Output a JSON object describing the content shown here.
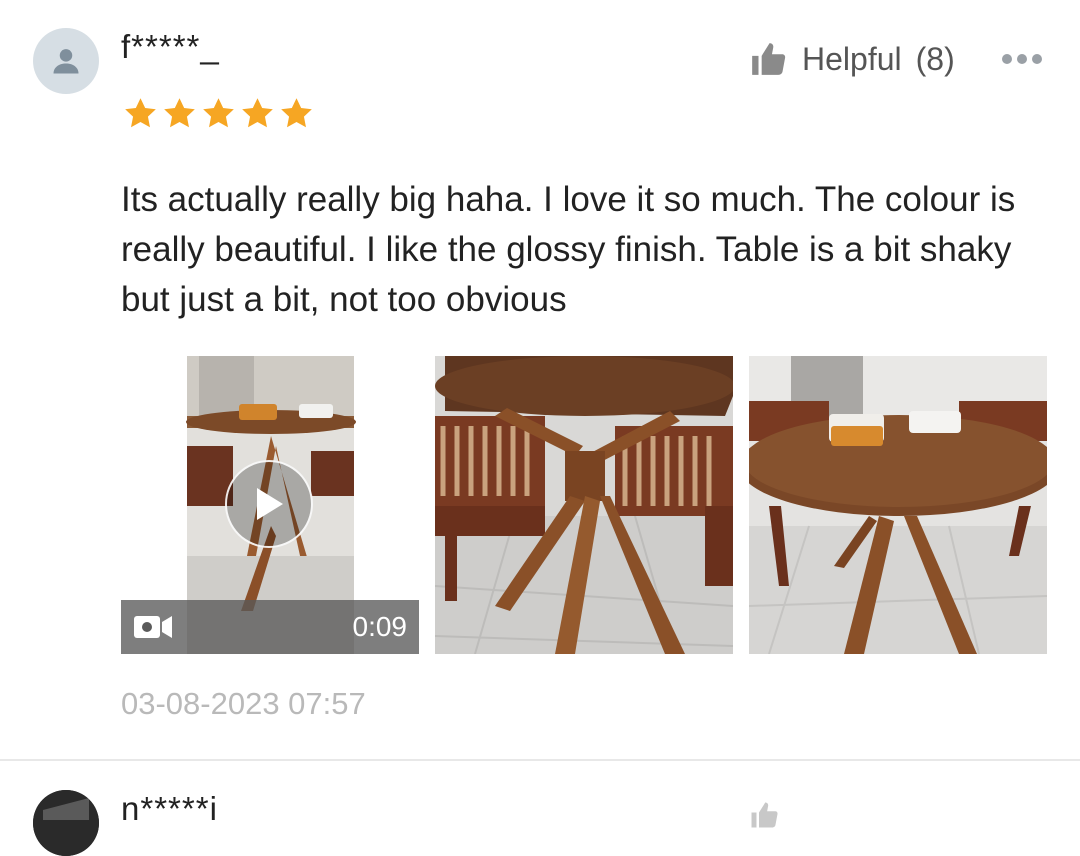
{
  "review": {
    "username": "f*****_",
    "rating": 5,
    "helpful_label": "Helpful",
    "helpful_count": "(8)",
    "text": "Its actually really big haha. I love it so much. The colour is really beautiful. I like the glossy finish. Table is a bit shaky but just a bit, not too obvious",
    "timestamp": "03-08-2023 07:57",
    "video": {
      "duration": "0:09",
      "icon": "video-camera-icon"
    },
    "photos": [
      {
        "name": "review-photo-1"
      },
      {
        "name": "review-photo-2"
      }
    ]
  },
  "next_review": {
    "username": "n*****i"
  },
  "colors": {
    "star": "#f6a623",
    "muted_text": "#b9b9b9",
    "avatar_bg": "#d6dee4"
  }
}
